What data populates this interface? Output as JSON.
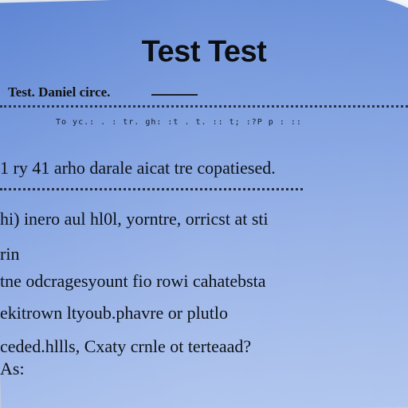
{
  "document": {
    "title": "Test Test",
    "subheading": "Test. Daniel circe.",
    "small_print": "To yc.: . : tr. gh: :t . t.  ::  t; :?P p : ::",
    "lines": [
      "1 ry 41 arho darale aicat tre copatiesed.",
      "hi) inero aul hl0l, yorntre, orricst at sti",
      "rin",
      "tne odcragesyount fio rowi cahatebsta",
      "ekitrown ltyoub.phavre or plutlo",
      "ceded.hllls, Cxaty crnle ot terteaad?",
      "As:"
    ]
  }
}
